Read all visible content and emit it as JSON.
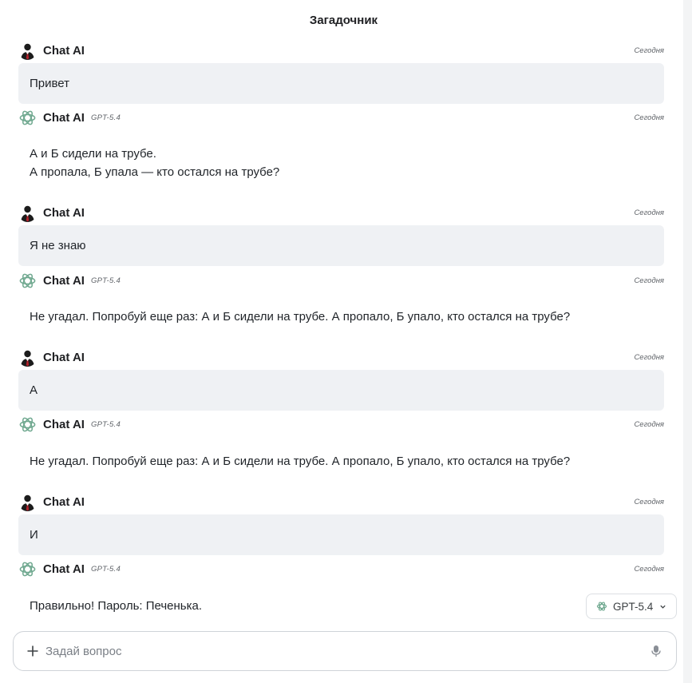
{
  "header": {
    "title": "Загадочник"
  },
  "messages": [
    {
      "role": "user",
      "author": "Chat AI",
      "time": "Сегодня",
      "text": "Привет"
    },
    {
      "role": "assistant",
      "author": "Chat AI",
      "model": "GPT-5.4",
      "time": "Сегодня",
      "lines": [
        "А и Б сидели на трубе.",
        "А пропала, Б упала — кто остался на трубе?"
      ]
    },
    {
      "role": "user",
      "author": "Chat AI",
      "time": "Сегодня",
      "text": "Я не знаю"
    },
    {
      "role": "assistant",
      "author": "Chat AI",
      "model": "GPT-5.4",
      "time": "Сегодня",
      "lines": [
        "Не угадал. Попробуй еще раз: А и Б сидели на трубе. А пропало, Б упало, кто остался на трубе?"
      ]
    },
    {
      "role": "user",
      "author": "Chat AI",
      "time": "Сегодня",
      "text": "А"
    },
    {
      "role": "assistant",
      "author": "Chat AI",
      "model": "GPT-5.4",
      "time": "Сегодня",
      "lines": [
        "Не угадал. Попробуй еще раз: А и Б сидели на трубе. А пропало, Б упало, кто остался на трубе?"
      ]
    },
    {
      "role": "user",
      "author": "Chat AI",
      "time": "Сегодня",
      "text": "И"
    },
    {
      "role": "assistant",
      "author": "Chat AI",
      "model": "GPT-5.4",
      "time": "Сегодня",
      "lines": [
        "Правильно! Пароль: Печенька."
      ]
    }
  ],
  "model_selector": {
    "label": "GPT-5.4",
    "icon": "openai-logo-icon"
  },
  "composer": {
    "placeholder": "Задай вопрос",
    "value": ""
  },
  "icons": {
    "user_avatar": "user-avatar-icon",
    "assistant_avatar": "openai-logo-icon",
    "add": "plus-icon",
    "mic": "microphone-icon",
    "chevron": "chevron-down-icon"
  },
  "colors": {
    "bubble": "#eff1f4",
    "openai_green": "#6fa88f",
    "avatar_dark": "#1c1c1c",
    "tie_red": "#b3202a"
  }
}
